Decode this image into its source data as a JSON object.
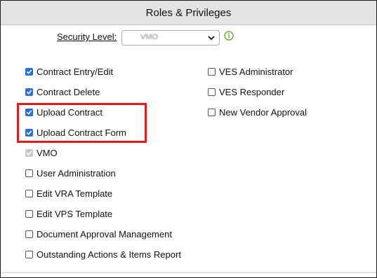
{
  "panel": {
    "title": "Roles & Privileges"
  },
  "security_level": {
    "label": "Security Level:",
    "selected": "VMO"
  },
  "left_checkboxes": [
    {
      "label": "Contract Entry/Edit",
      "checked": true
    },
    {
      "label": "Contract Delete",
      "checked": true
    },
    {
      "label": "Upload Contract",
      "checked": true
    },
    {
      "label": "Upload Contract Form",
      "checked": true
    },
    {
      "label": "VMO",
      "checked": true,
      "disabled": true
    },
    {
      "label": "User Administration",
      "checked": false
    },
    {
      "label": "Edit VRA Template",
      "checked": false
    },
    {
      "label": "Edit VPS Template",
      "checked": false
    },
    {
      "label": "Document Approval Management",
      "checked": false
    },
    {
      "label": "Outstanding Actions & Items Report",
      "checked": false
    }
  ],
  "right_checkboxes": [
    {
      "label": "VES Administrator",
      "checked": false
    },
    {
      "label": "VES Responder",
      "checked": false
    },
    {
      "label": "New Vendor Approval",
      "checked": false
    }
  ],
  "colors": {
    "checkbox_checked": "#2e6fd6",
    "highlight_box": "#e01b1b",
    "info_icon": "#5aa51a"
  }
}
